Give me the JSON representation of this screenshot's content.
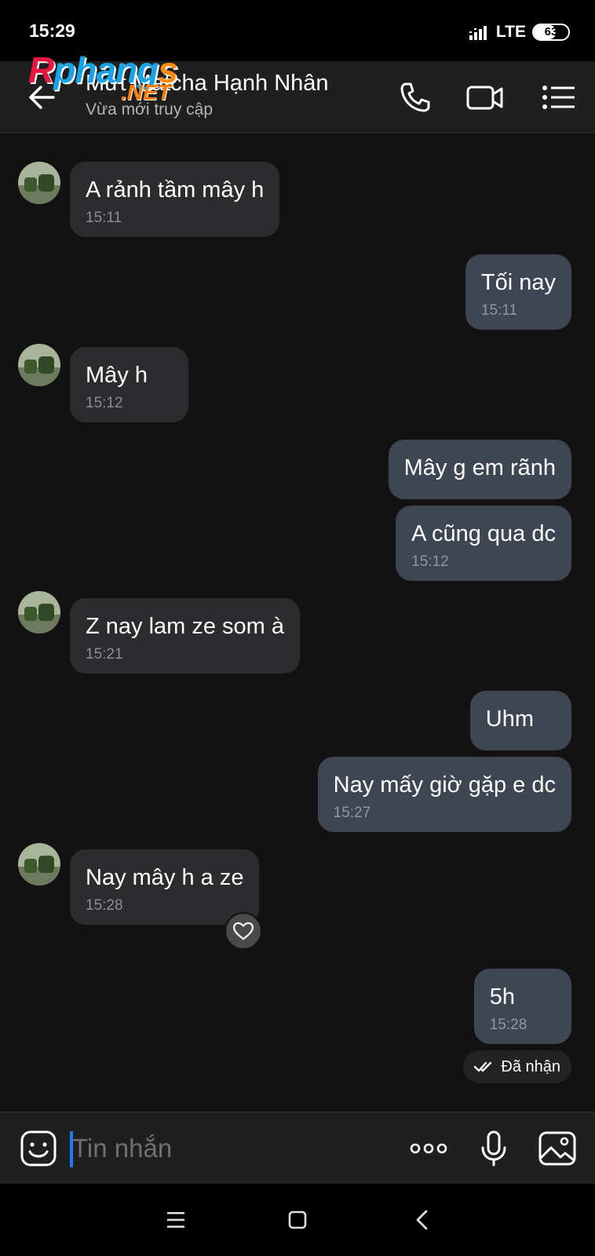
{
  "status_bar": {
    "time": "15:29",
    "network": "LTE",
    "battery": "63",
    "battery_level": 0.63
  },
  "header": {
    "contact_name": "Mứt Matcha Hạnh Nhân",
    "contact_status": "Vừa mới truy cập",
    "watermark_main": "Rphangs",
    "watermark_net": ".NET",
    "icons": [
      "back-arrow-icon",
      "phone-icon",
      "video-call-icon",
      "menu-list-icon"
    ]
  },
  "messages": [
    {
      "dir": "in",
      "text": "A rảnh tầm mây h",
      "time": "15:11"
    },
    {
      "dir": "out",
      "text": "Tối nay",
      "time": "15:11"
    },
    {
      "dir": "in",
      "text": "Mây h",
      "time": "15:12"
    },
    {
      "dir": "out",
      "text": "Mây g em rãnh",
      "time": ""
    },
    {
      "dir": "out",
      "text": "A cũng qua dc",
      "time": "15:12"
    },
    {
      "dir": "in",
      "text": "Z nay lam ze som à",
      "time": "15:21"
    },
    {
      "dir": "out",
      "text": "Uhm",
      "time": ""
    },
    {
      "dir": "out",
      "text": "Nay mấy giờ gặp e dc",
      "time": "15:27"
    },
    {
      "dir": "in",
      "text": "Nay mây h a ze",
      "time": "15:28"
    },
    {
      "dir": "out",
      "text": "5h",
      "time": "15:28"
    }
  ],
  "delivery_status": "Đã nhận",
  "composer": {
    "placeholder": "Tin nhắn",
    "icons": [
      "sticker-icon",
      "more-options-icon",
      "microphone-icon",
      "image-icon"
    ]
  },
  "colors": {
    "background": "#121212",
    "incoming_bubble": "#2c2c2e",
    "outgoing_bubble": "#3e4653",
    "accent": "#1a7cf5"
  }
}
